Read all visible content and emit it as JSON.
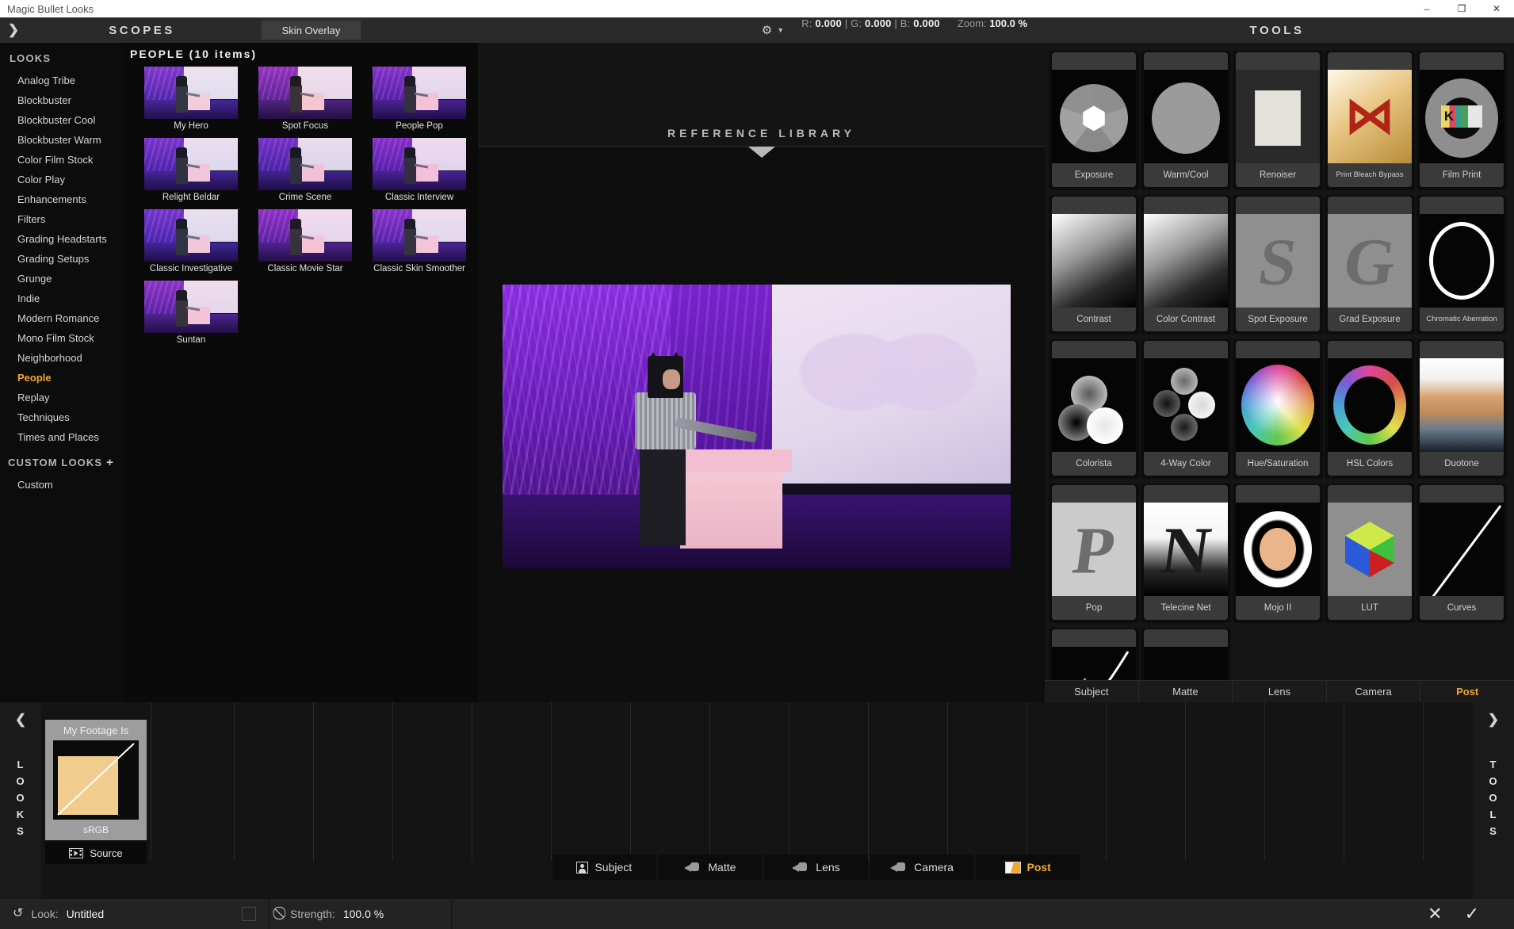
{
  "window": {
    "title": "Magic Bullet Looks",
    "minimize": "–",
    "maximize": "❐",
    "close": "✕"
  },
  "toolbar": {
    "collapse_arrow": "❯",
    "scopes_label": "SCOPES",
    "skin_overlay_label": "Skin Overlay",
    "gear_icon": "⚙",
    "caret": "▼",
    "readout_r_label": "R:",
    "readout_r_value": "0.000",
    "readout_g_label": "G:",
    "readout_g_value": "0.000",
    "readout_b_label": "B:",
    "readout_b_value": "0.000",
    "zoom_label": "Zoom:",
    "zoom_value": "100.0 %",
    "tools_label": "TOOLS"
  },
  "sidebar": {
    "header": "LOOKS",
    "items": [
      "Analog Tribe",
      "Blockbuster",
      "Blockbuster Cool",
      "Blockbuster Warm",
      "Color Film Stock",
      "Color Play",
      "Enhancements",
      "Filters",
      "Grading Headstarts",
      "Grading Setups",
      "Grunge",
      "Indie",
      "Modern Romance",
      "Mono Film Stock",
      "Neighborhood",
      "People",
      "Replay",
      "Techniques",
      "Times and Places"
    ],
    "active": "People",
    "custom_header": "CUSTOM LOOKS",
    "custom_plus": "+",
    "custom_items": [
      "Custom"
    ]
  },
  "presets": {
    "title": "PEOPLE (10 items)",
    "items": [
      {
        "label": "My Hero",
        "tint": "#bfd7e8"
      },
      {
        "label": "Spot Focus",
        "tint": "#f0b8b0"
      },
      {
        "label": "People Pop",
        "tint": "#caa8d8"
      },
      {
        "label": "Relight Beldar",
        "tint": "#a8b6e0"
      },
      {
        "label": "Crime Scene",
        "tint": "#9aa8d0"
      },
      {
        "label": "Classic Interview",
        "tint": "#c79ae0"
      },
      {
        "label": "Classic Investigative",
        "tint": "#9fc4e8"
      },
      {
        "label": "Classic Movie Star",
        "tint": "#e8a6cf"
      },
      {
        "label": "Classic Skin Smoother",
        "tint": "#d2b4e0"
      },
      {
        "label": "Suntan",
        "tint": "#e0b0cf"
      }
    ]
  },
  "viewer": {
    "reference_library_label": "REFERENCE LIBRARY"
  },
  "tools": {
    "panel_title": "TOOLS",
    "tiles": [
      {
        "label": "Exposure",
        "art": "aperture"
      },
      {
        "label": "Warm/Cool",
        "art": "circle"
      },
      {
        "label": "Renoiser",
        "art": "renoiser"
      },
      {
        "label": "Print Bleach Bypass",
        "art": "bleach"
      },
      {
        "label": "Film Print",
        "art": "filmprint"
      },
      {
        "label": "Contrast",
        "art": "gradient"
      },
      {
        "label": "Color Contrast",
        "art": "gradient"
      },
      {
        "label": "Spot Exposure",
        "art": "letter-s"
      },
      {
        "label": "Grad Exposure",
        "art": "letter-g"
      },
      {
        "label": "Chromatic Aberration",
        "art": "ring"
      },
      {
        "label": "Colorista",
        "art": "colorista"
      },
      {
        "label": "4-Way Color",
        "art": "fourway"
      },
      {
        "label": "Hue/Saturation",
        "art": "huewheel"
      },
      {
        "label": "HSL Colors",
        "art": "hslring"
      },
      {
        "label": "Duotone",
        "art": "duotone"
      },
      {
        "label": "Pop",
        "art": "letter-p"
      },
      {
        "label": "Telecine Net",
        "art": "telecine"
      },
      {
        "label": "Mojo II",
        "art": "mojo"
      },
      {
        "label": "LUT",
        "art": "lut"
      },
      {
        "label": "Curves",
        "art": "curves"
      },
      {
        "label": "",
        "art": "subjectcurve"
      },
      {
        "label": "",
        "art": "mattecurve"
      }
    ],
    "tabs": [
      {
        "label": "Subject",
        "active": false
      },
      {
        "label": "Matte",
        "active": false
      },
      {
        "label": "Lens",
        "active": false
      },
      {
        "label": "Camera",
        "active": false
      },
      {
        "label": "Post",
        "active": true
      }
    ]
  },
  "bottom": {
    "looks_rail_label": "LOOKS",
    "tools_rail_label": "TOOLS",
    "left_arrow": "❮",
    "right_arrow": "❯",
    "footage": {
      "title": "My Footage Is",
      "colorspace": "sRGB",
      "source_label": "Source"
    },
    "stage_buttons": [
      {
        "label": "Subject",
        "icon": "person-icon",
        "active": false
      },
      {
        "label": "Matte",
        "icon": "lightstand-icon",
        "active": false
      },
      {
        "label": "Lens",
        "icon": "lightstand-icon",
        "active": false
      },
      {
        "label": "Camera",
        "icon": "lightstand-icon",
        "active": false
      },
      {
        "label": "Post",
        "icon": "post-swatch-icon",
        "active": true
      }
    ]
  },
  "statusbar": {
    "reset_icon": "↺",
    "look_label": "Look:",
    "look_value": "Untitled",
    "disable_icon": "⃠",
    "strength_label": "Strength:",
    "strength_value": "100.0 %",
    "cancel_icon": "✕",
    "confirm_icon": "✓"
  },
  "colors": {
    "accent": "#f0a830",
    "panel": "#151515",
    "background": "#0a0a0a"
  }
}
